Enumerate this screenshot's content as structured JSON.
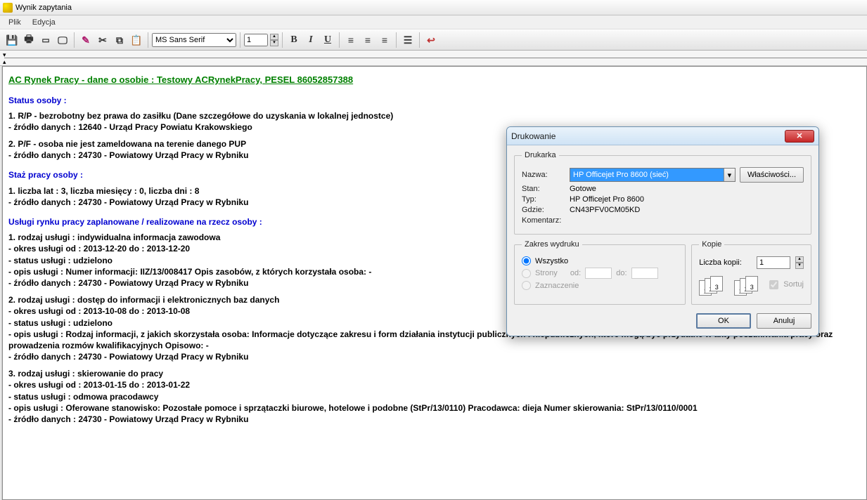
{
  "window": {
    "title": "Wynik zapytania"
  },
  "menu": {
    "file": "Plik",
    "edit": "Edycja"
  },
  "toolbar": {
    "font_name": "MS Sans Serif",
    "font_size": "1"
  },
  "doc": {
    "title": "AC Rynek Pracy - dane o osobie : Testowy ACRynekPracy, PESEL 86052857388",
    "s1_head": "Status osoby :",
    "s1_l1": "1. R/P - bezrobotny bez prawa do zasiłku (Dane szczegółowe do uzyskania w lokalnej jednostce)",
    "s1_l2": " - źródło danych : 12640 - Urząd Pracy Powiatu Krakowskiego",
    "s1_l3": "2. P/F - osoba nie jest zameldowana na terenie danego PUP",
    "s1_l4": " - źródło danych : 24730 - Powiatowy Urząd Pracy w Rybniku",
    "s2_head": "Staż pracy osoby :",
    "s2_l1": "1. liczba lat : 3, liczba miesięcy : 0, liczba dni : 8",
    "s2_l2": " - źródło danych : 24730 - Powiatowy Urząd Pracy w Rybniku",
    "s3_head": "Usługi rynku pracy zaplanowane / realizowane na rzecz osoby :",
    "s3_b1_l1": "1. rodzaj usługi : indywidualna informacja zawodowa",
    "s3_b1_l2": " - okres usługi od : 2013-12-20 do : 2013-12-20",
    "s3_b1_l3": " - status usługi : udzielono",
    "s3_b1_l4": " - opis usługi : Numer informacji: IIZ/13/008417 Opis zasobów, z których korzystała osoba: -",
    "s3_b1_l5": " - źródło danych : 24730 - Powiatowy Urząd Pracy w Rybniku",
    "s3_b2_l1": "2. rodzaj usługi : dostęp do informacji i elektronicznych baz danych",
    "s3_b2_l2": " - okres usługi od : 2013-10-08 do : 2013-10-08",
    "s3_b2_l3": " - status usługi : udzielono",
    "s3_b2_l4": " - opis usługi : Rodzaj informacji, z jakich skorzystała osoba: Informacje dotyczące zakresu i form działania instytucji publicznych i niepublicznych, które mogą być przydatne w akty poszukiwania pracy oraz prowadzenia rozmów kwalifikacyjnych Opisowo: -",
    "s3_b2_l5": " - źródło danych : 24730 - Powiatowy Urząd Pracy w Rybniku",
    "s3_b3_l1": "3. rodzaj usługi : skierowanie do pracy",
    "s3_b3_l2": " - okres usługi od : 2013-01-15 do : 2013-01-22",
    "s3_b3_l3": " - status usługi : odmowa pracodawcy",
    "s3_b3_l4": " - opis usługi : Oferowane stanowisko: Pozostałe pomoce i sprzątaczki biurowe, hotelowe i podobne (StPr/13/0110) Pracodawca: dieja Numer skierowania: StPr/13/0110/0001",
    "s3_b3_l5": " - źródło danych : 24730 - Powiatowy Urząd Pracy w Rybniku"
  },
  "print": {
    "title": "Drukowanie",
    "printer_group": "Drukarka",
    "name_lbl": "Nazwa:",
    "name_val": "HP Officejet Pro 8600 (sieć)",
    "props_btn": "Właściwości...",
    "state_lbl": "Stan:",
    "state_val": "Gotowe",
    "type_lbl": "Typ:",
    "type_val": "HP Officejet Pro 8600",
    "where_lbl": "Gdzie:",
    "where_val": "CN43PFV0CM05KD",
    "comment_lbl": "Komentarz:",
    "range_group": "Zakres wydruku",
    "range_all": "Wszystko",
    "range_pages": "Strony",
    "range_from": "od:",
    "range_to": "do:",
    "range_sel": "Zaznaczenie",
    "copies_group": "Kopie",
    "copies_lbl": "Liczba kopii:",
    "copies_val": "1",
    "collate": "Sortuj",
    "ok": "OK",
    "cancel": "Anuluj"
  }
}
